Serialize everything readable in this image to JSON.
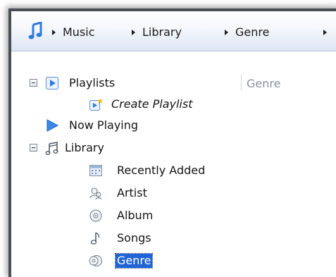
{
  "breadcrumb": {
    "items": [
      {
        "label": "Music"
      },
      {
        "label": "Library"
      },
      {
        "label": "Genre"
      }
    ]
  },
  "tree": {
    "playlists": "Playlists",
    "create_playlist": "Create Playlist",
    "now_playing": "Now Playing",
    "library": "Library",
    "recently_added": "Recently Added",
    "artist": "Artist",
    "album": "Album",
    "songs": "Songs",
    "genre": "Genre"
  },
  "content": {
    "column_header": "Genre"
  },
  "colors": {
    "selection": "#1f63d6",
    "accent_blue": "#2d7be0",
    "border_dark": "#4a4f57"
  },
  "icons": {
    "app": "music-note-icon",
    "playlists": "playlist-icon",
    "create_playlist": "new-playlist-icon",
    "now_playing": "play-icon",
    "library": "library-icon",
    "recently_added": "calendar-icon",
    "artist": "artist-icon",
    "album": "album-icon",
    "songs": "song-note-icon",
    "genre": "genre-icon"
  }
}
